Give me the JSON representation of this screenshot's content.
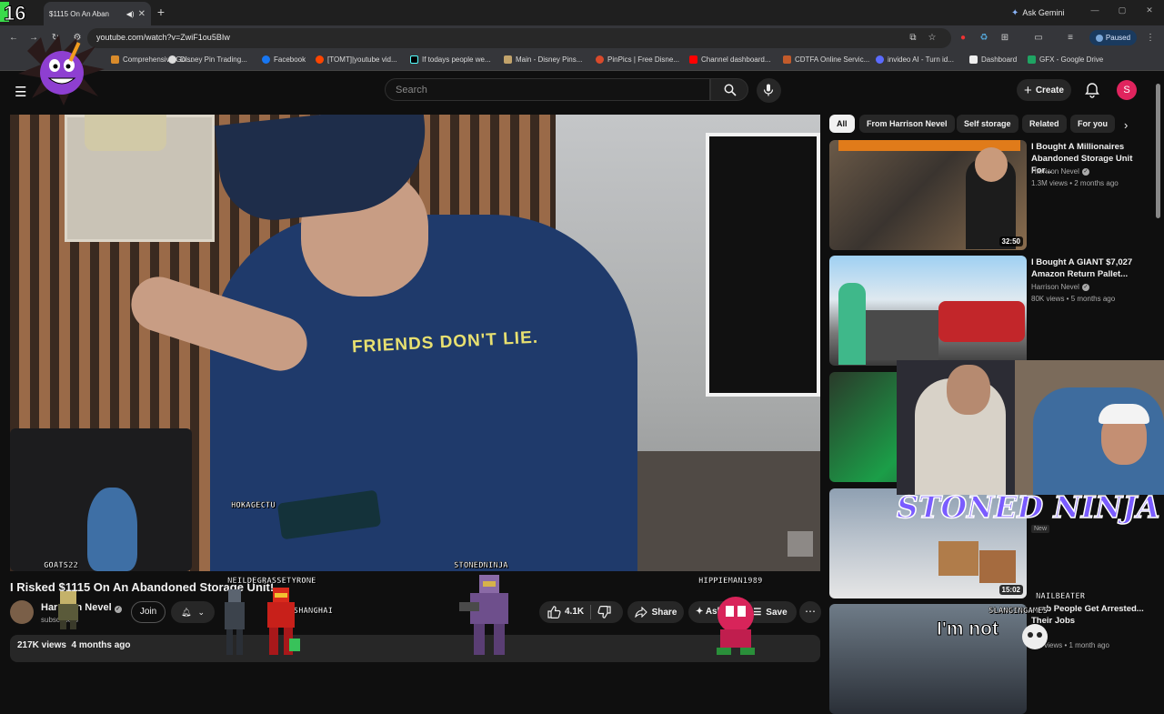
{
  "browser": {
    "tab_title": "$1115 On An Aban",
    "new_tab_symbol": "+",
    "ask_gemini": "Ask Gemini",
    "url": "youtube.com/watch?v=ZwiF1ou5BIw",
    "profile_status": "Paused",
    "bookmarks": [
      {
        "label": "Comprehensive Gol...",
        "color": "#d98b2b"
      },
      {
        "label": "Disney Pin Trading...",
        "color": "#dddddd"
      },
      {
        "label": "Facebook",
        "color": "#1877f2"
      },
      {
        "label": "[TOMT]|youtube vid...",
        "color": "#ff4500"
      },
      {
        "label": "If todays people we...",
        "color": "#000000"
      },
      {
        "label": "Main - Disney Pins...",
        "color": "#c2a36b"
      },
      {
        "label": "PinPics | Free Disne...",
        "color": "#d94a2b"
      },
      {
        "label": "Channel dashboard...",
        "color": "#ff0000"
      },
      {
        "label": "CDTFA Online Servic...",
        "color": "#c25b2b"
      },
      {
        "label": "invideo AI - Turn id...",
        "color": "#5b6bff"
      },
      {
        "label": "Dashboard",
        "color": "#eeeeee"
      },
      {
        "label": "GFX - Google Drive",
        "color": "#1fa463"
      }
    ]
  },
  "youtube": {
    "search_placeholder": "Search",
    "create_label": "Create",
    "avatar_letter": "S",
    "video": {
      "title": "I Risked $1115 On An Abandoned Storage Unit!",
      "poster_text": "\"G in i Figu Allite HIGH 1280 P GA 303",
      "slogan": "FRIENDS DON'T LIE."
    },
    "channel": {
      "name": "Harrison Nevel",
      "subs": "subscribers",
      "join_label": "Join"
    },
    "actions": {
      "likes": "4.1K",
      "share": "Share",
      "ask": "Ask",
      "save": "Save",
      "more": "⋯"
    },
    "description": {
      "views": "217K views",
      "age": "4 months ago"
    },
    "chips": [
      "All",
      "From Harrison Nevel",
      "Self storage",
      "Related",
      "For you"
    ],
    "recommendations": [
      {
        "title": "I Bought A Millionaires Abandoned Storage Unit For...",
        "channel": "Harrison Nevel",
        "meta": "1.3M views • 2 months ago",
        "duration": "32:50"
      },
      {
        "title": "I Bought A GIANT $7,027 Amazon Return Pallet...",
        "channel": "Harrison Nevel",
        "meta": "80K views • 5 months ago",
        "duration": ""
      },
      {
        "title": "",
        "channel": "",
        "meta": "",
        "duration": ""
      },
      {
        "title": "",
        "channel": "",
        "meta": "New",
        "duration": "15:02"
      },
      {
        "title": "...mb People Get Arrested... Their Jobs",
        "channel": "",
        "meta": "...K views • 1 month ago",
        "duration": ""
      }
    ]
  },
  "overlay": {
    "counter": "16",
    "stoned_banner": "STONED NINJA",
    "im_not": "I'm not",
    "chat_names": [
      {
        "name": "HOKAGECTU",
        "color": "#ffffff"
      },
      {
        "name": "GOATS22",
        "color": "#ffffff"
      },
      {
        "name": "NEILDEGRASSETYRONE",
        "color": "#ffffff"
      },
      {
        "name": "STONEDNINJA",
        "color": "#ffffff"
      },
      {
        "name": "HIPPIEMAN1989",
        "color": "#ffffff"
      },
      {
        "name": "SNOWSHANGHAI",
        "color": "#ffffff"
      },
      {
        "name": "NAILBEATER",
        "color": "#ffffff"
      },
      {
        "name": "SLANGINGAMES",
        "color": "#ffffff"
      }
    ]
  },
  "colors": {
    "background": "#0f0f0f",
    "chip_bg": "#272727",
    "yt_red": "#ff0000",
    "banner_purple": "#7a5cff"
  },
  "icons": [
    "menu-icon",
    "search-icon",
    "mic-icon",
    "plus-icon",
    "bell-icon",
    "like-icon",
    "dislike-icon",
    "share-icon",
    "save-icon",
    "verified-icon",
    "chevron-right-icon"
  ]
}
